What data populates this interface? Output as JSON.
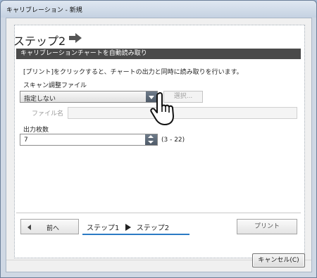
{
  "window": {
    "title": "キャリブレーション - 新規"
  },
  "step": {
    "title": "ステップ2"
  },
  "section": {
    "header": "キャリブレーションチャートを自動読み取り"
  },
  "instruction": "[プリント]をクリックすると、チャートの出力と同時に読み取りを行います。",
  "scan_file": {
    "label": "スキャン調整ファイル",
    "selected": "指定しない",
    "browse_label": "選択..."
  },
  "file_name": {
    "label": "ファイル名",
    "value": ""
  },
  "copies": {
    "label": "出力枚数",
    "value": "7",
    "range": "(3 - 22)"
  },
  "nav": {
    "prev_label": "前へ",
    "step1": "ステップ1",
    "step2": "ステップ2",
    "print_label": "プリント"
  },
  "footer": {
    "cancel_label": "キャンセル(C)"
  },
  "colors": {
    "section_bar": "#4a4a4a",
    "step_underline": "#2b7bc4"
  },
  "icons": [
    "right-arrow-icon",
    "dropdown-arrow-icon",
    "spin-up-icon",
    "spin-down-icon",
    "left-arrow-icon",
    "step-triangle-icon",
    "hand-cursor-icon"
  ]
}
